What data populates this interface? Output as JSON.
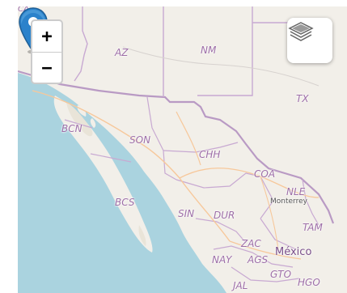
{
  "zoom_control": {
    "zoom_in_label": "+",
    "zoom_out_label": "−"
  },
  "layers_control": {
    "icon": "layers-icon"
  },
  "marker": {
    "icon": "map-pin-icon",
    "color": "#2b82cb"
  },
  "map_labels": {
    "ca_partial": "CA",
    "az": "AZ",
    "nm": "NM",
    "tx": "TX",
    "bcn": "BCN",
    "son": "SON",
    "chh": "CHH",
    "coa": "COA",
    "nle": "NLE",
    "bcs": "BCS",
    "sin": "SIN",
    "dur": "DUR",
    "tam": "TAM",
    "zac": "ZAC",
    "nay": "NAY",
    "ags": "AGS",
    "gto": "GTO",
    "hgo": "HGO",
    "jal": "JAL",
    "monterrey": "Monterrey",
    "mexico": "México"
  },
  "colors": {
    "water": "#aad3df",
    "land": "#f2efe9",
    "border": "#b99ac4"
  }
}
